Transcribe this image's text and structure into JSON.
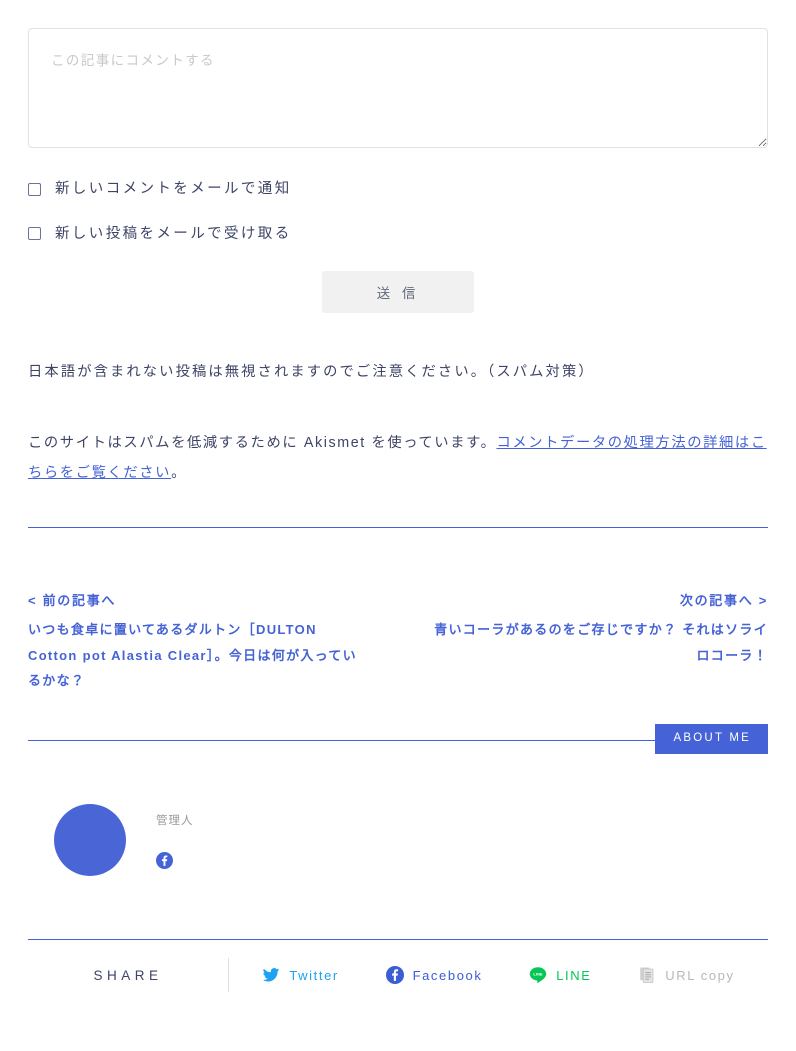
{
  "comment_form": {
    "textarea_placeholder": "この記事にコメントする",
    "textarea_value": "",
    "checkboxes": [
      {
        "label": "新しいコメントをメールで通知",
        "checked": false
      },
      {
        "label": "新しい投稿をメールで受け取る",
        "checked": false
      }
    ],
    "submit_label": "送 信",
    "notice": "日本語が含まれない投稿は無視されますのでご注意ください。（スパム対策）",
    "akismet": {
      "text_before": "このサイトはスパムを低減するために Akismet を使っています。",
      "link_text": "コメントデータの処理方法の詳細はこちらをご覧ください",
      "text_after": "。"
    }
  },
  "post_nav": {
    "prev": {
      "meta": "< 前の記事へ",
      "title": "いつも食卓に置いてあるダルトン［DULTON Cotton pot Alastia Clear］。今日は何が入っているかな？"
    },
    "next": {
      "meta": "次の記事へ >",
      "title": "青いコーラがあるのをご存じですか？ それはソライロコーラ！"
    }
  },
  "author_box": {
    "badge_label": "ABOUT ME",
    "name": "管理人",
    "avatar_color": "#4a66d6",
    "social": [
      {
        "icon": "facebook-icon",
        "color": "#4563d6"
      }
    ]
  },
  "share": {
    "label": "SHARE",
    "items": [
      {
        "label": "Twitter",
        "icon": "twitter-icon",
        "color": "#1da1f2"
      },
      {
        "label": "Facebook",
        "icon": "facebook-icon",
        "color": "#3b5dd6"
      },
      {
        "label": "LINE",
        "icon": "line-icon",
        "color": "#06c755"
      },
      {
        "label": "URL copy",
        "icon": "copy-document-icon",
        "color": "#b8b8b8"
      }
    ]
  },
  "theme": {
    "accent": "#4563d6",
    "text": "#3d4466",
    "muted": "#9a9a9a",
    "border_light": "#e2e2e2"
  }
}
